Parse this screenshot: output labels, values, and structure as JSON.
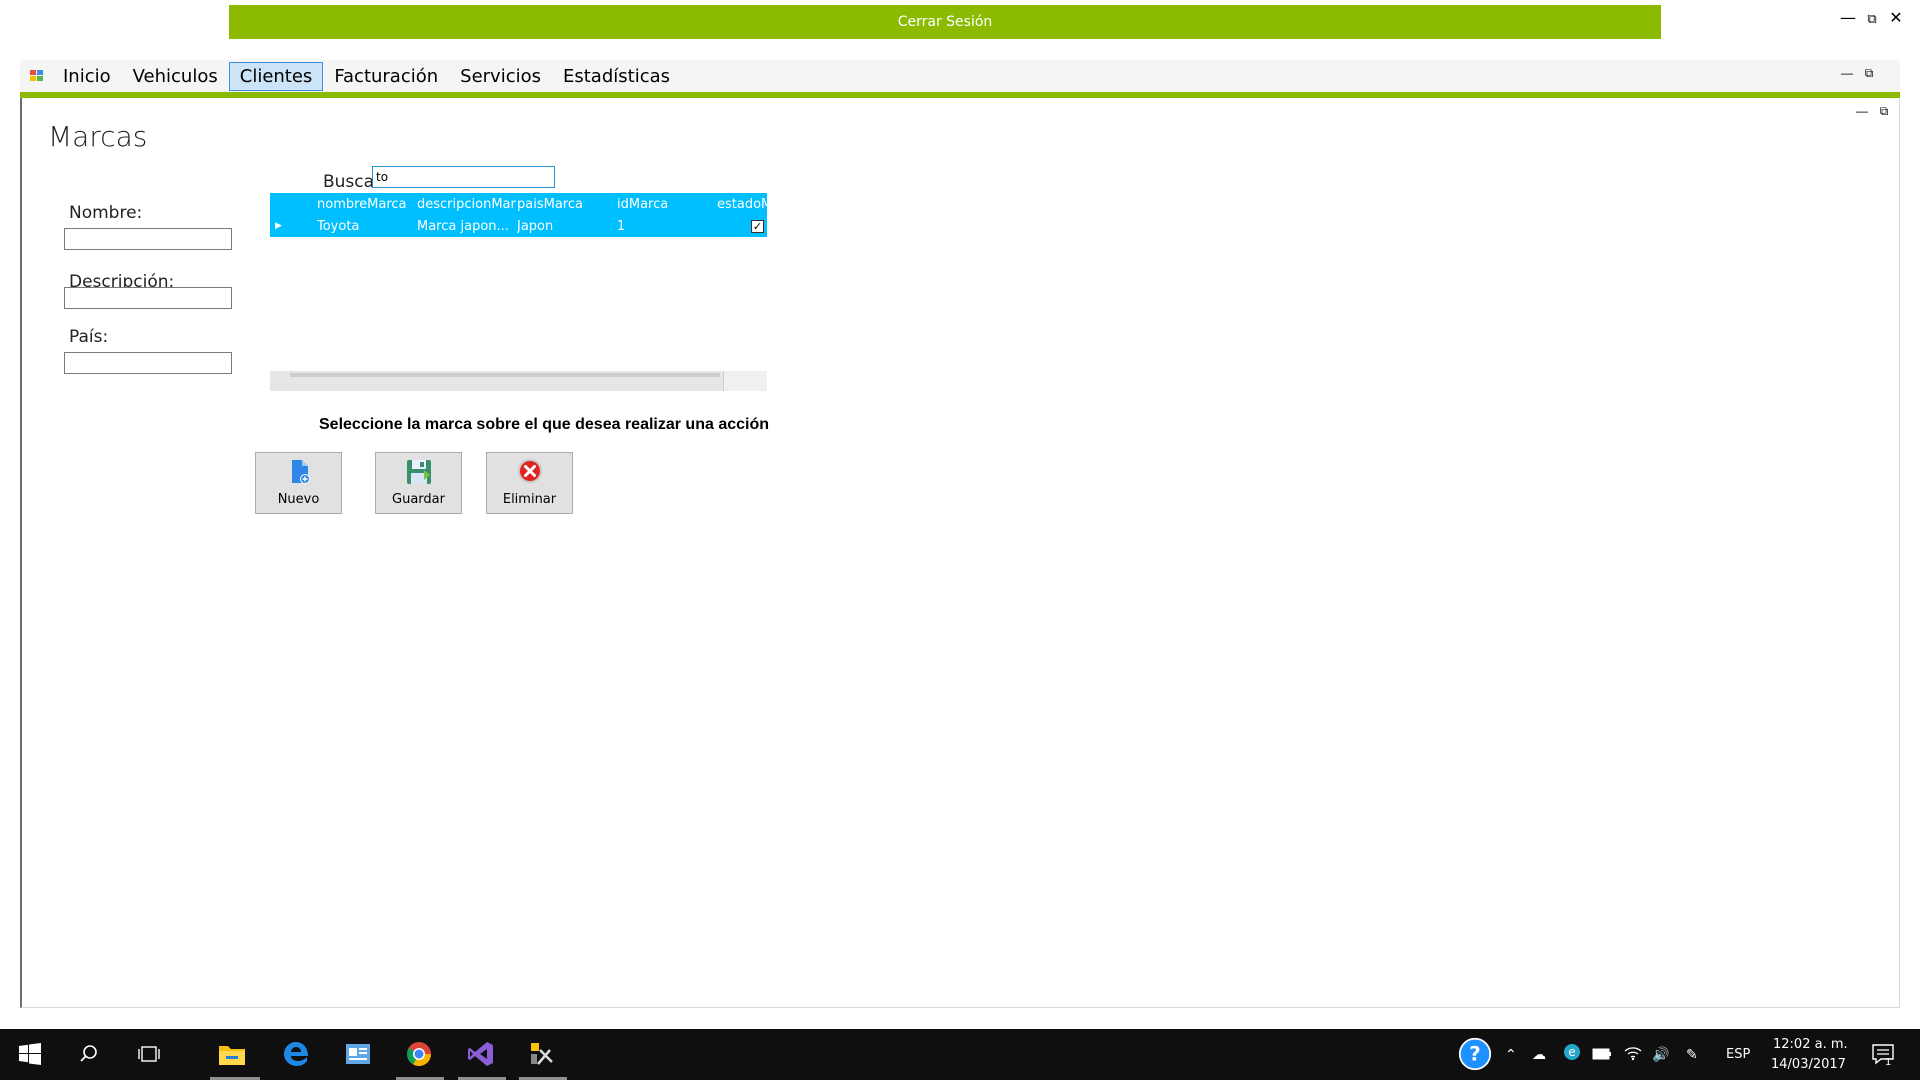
{
  "app": {
    "logout_label": "Cerrar Sesión",
    "window_controls": [
      "minimize",
      "restore",
      "close"
    ]
  },
  "menu": {
    "items": [
      {
        "label": "Inicio",
        "active": false
      },
      {
        "label": "Vehiculos",
        "active": false
      },
      {
        "label": "Clientes",
        "active": true
      },
      {
        "label": "Facturación",
        "active": false
      },
      {
        "label": "Servicios",
        "active": false
      },
      {
        "label": "Estadísticas",
        "active": false
      }
    ]
  },
  "form": {
    "title": "Marcas",
    "nombre_label": "Nombre:",
    "nombre_value": "",
    "descripcion_label": "Descripción:",
    "descripcion_value": "",
    "pais_label": "País:",
    "pais_value": ""
  },
  "search": {
    "label": "Buscar",
    "value": "to"
  },
  "grid": {
    "columns": [
      "nombreMarca",
      "descripcionMar",
      "paisMarca",
      "idMarca",
      "estadoM"
    ],
    "rows": [
      {
        "nombreMarca": "Toyota",
        "descripcionMarca": "Marca japon...",
        "paisMarca": "Japon",
        "idMarca": "1",
        "estadoMarca": true
      }
    ],
    "colors": {
      "header_bg": "#00bfff",
      "row_selected_bg": "#00bfff"
    }
  },
  "hint": "Seleccione la marca sobre el que desea realizar una acción",
  "actions": {
    "nuevo": "Nuevo",
    "guardar": "Guardar",
    "eliminar": "Eliminar"
  },
  "taskbar": {
    "apps": [
      "start-icon",
      "search-icon",
      "task-view-icon",
      "file-explorer-icon",
      "edge-icon",
      "outlook-icon",
      "chrome-icon",
      "visual-studio-icon",
      "tools-icon"
    ],
    "language": "ESP",
    "time": "12:02 a. m.",
    "date": "14/03/2017",
    "notifications": "1"
  },
  "colors": {
    "accent_green": "#8cba00",
    "grid_blue": "#00bfff",
    "menu_active_bg": "#cce4f7"
  }
}
